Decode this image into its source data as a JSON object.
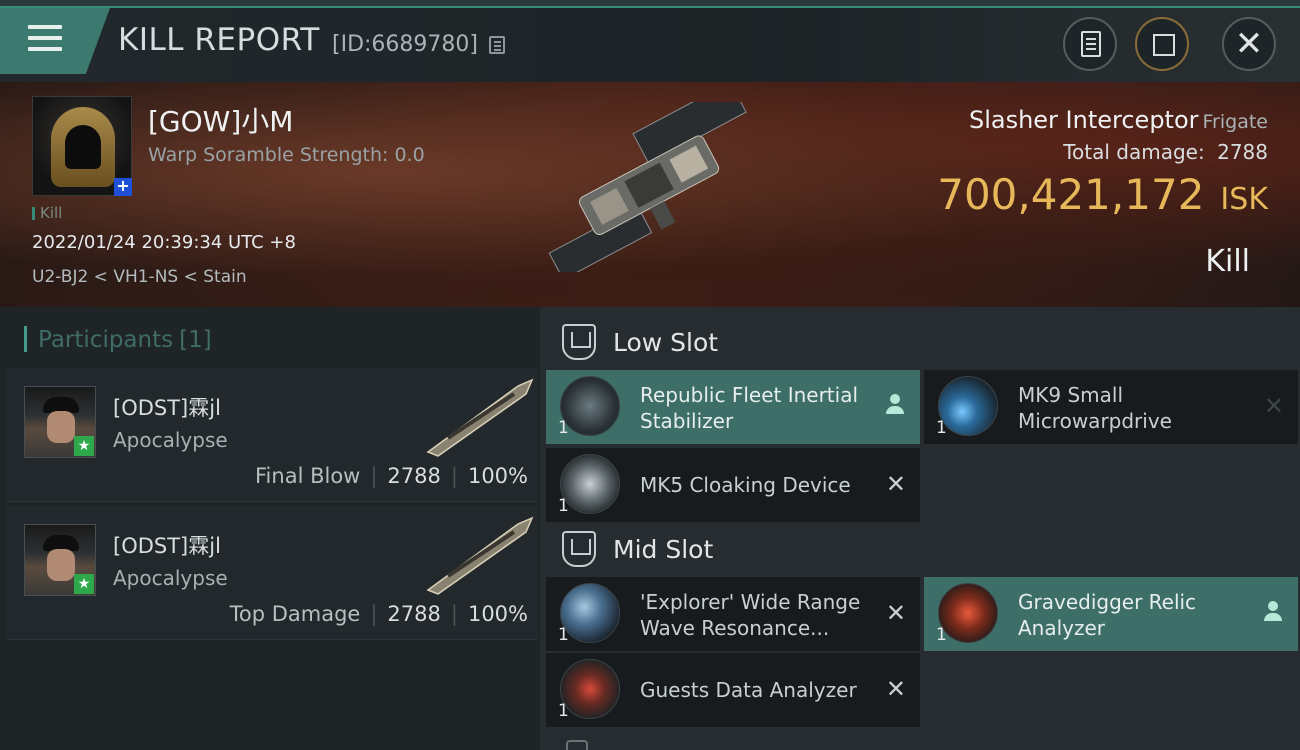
{
  "header": {
    "title": "KILL REPORT",
    "report_id": "[ID:6689780]"
  },
  "victim": {
    "name": "[GOW]小M",
    "scramble": "Warp Soramble Strength: 0.0",
    "tag": "Kill",
    "datetime": "2022/01/24 20:39:34 UTC +8",
    "location": "U2-BJ2 < VH1-NS < Stain",
    "ship_name": "Slasher Interceptor",
    "ship_class": "Frigate",
    "total_damage_label": "Total damage:",
    "total_damage": "2788",
    "isk_value": "700,421,172",
    "isk_unit": "ISK",
    "result": "Kill"
  },
  "participants": {
    "title": "Participants",
    "count": "[1]",
    "rows": [
      {
        "name": "[ODST]霖jl",
        "ship": "Apocalypse",
        "role": "Final Blow",
        "damage": "2788",
        "percent": "100%"
      },
      {
        "name": "[ODST]霖jl",
        "ship": "Apocalypse",
        "role": "Top Damage",
        "damage": "2788",
        "percent": "100%"
      }
    ]
  },
  "low_slot": {
    "title": "Low Slot",
    "modules": [
      {
        "name": "Republic Fleet Inertial Stabilizer",
        "qty": "1",
        "status": "dropped"
      },
      {
        "name": "MK9 Small Microwarpdrive",
        "qty": "1",
        "status": "destroyed"
      },
      {
        "name": "MK5 Cloaking Device",
        "qty": "1",
        "status": "destroyed"
      }
    ]
  },
  "mid_slot": {
    "title": "Mid Slot",
    "modules": [
      {
        "name": "'Explorer' Wide Range Wave Resonance...",
        "qty": "1",
        "status": "destroyed"
      },
      {
        "name": "Gravedigger Relic Analyzer",
        "qty": "1",
        "status": "dropped"
      },
      {
        "name": "Guests Data Analyzer",
        "qty": "1",
        "status": "destroyed"
      }
    ]
  },
  "icons": {
    "menu": "menu-icon",
    "copy": "copy-icon",
    "clipboard": "clipboard-icon",
    "share": "share-icon",
    "close": "close-icon"
  },
  "colors": {
    "accent": "#3e6e68",
    "isk": "#e6b85a",
    "badge_plus": "#2050d8",
    "badge_star": "#2ea84a"
  }
}
